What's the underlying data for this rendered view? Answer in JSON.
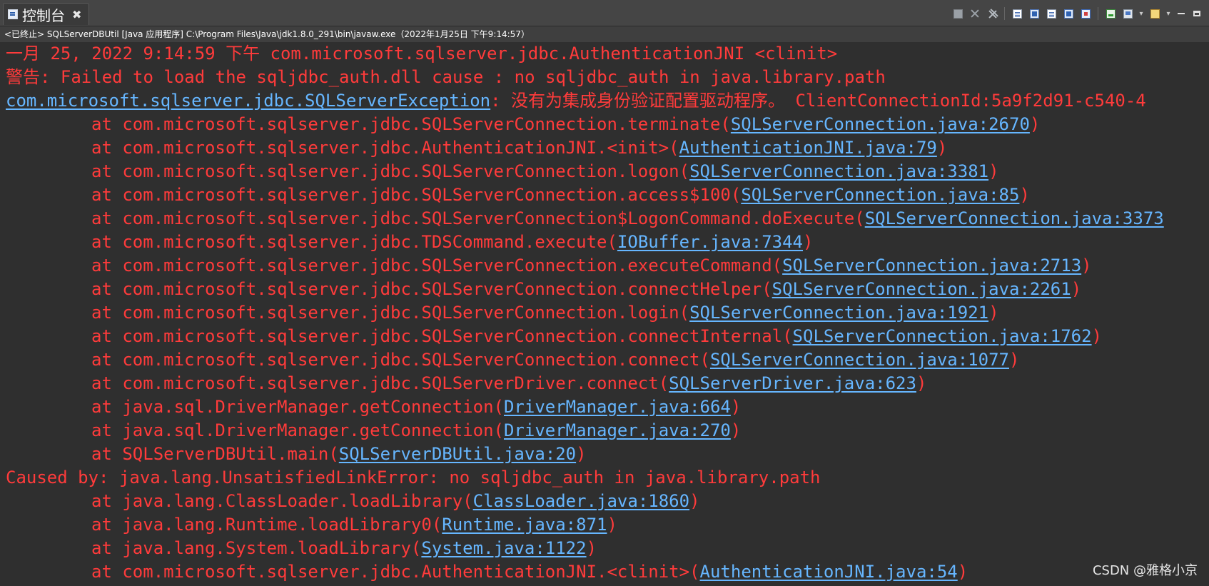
{
  "tab": {
    "title": "控制台",
    "close_label": "✖"
  },
  "status_line": "<已终止> SQLServerDBUtil [Java 应用程序] C:\\Program Files\\Java\\jdk1.8.0_291\\bin\\javaw.exe（2022年1月25日 下午9:14:57）",
  "toolbar": {
    "icons": [
      "terminate-icon",
      "remove-launch-icon",
      "remove-all-terminated-icon",
      "scroll-lock-icon",
      "word-wrap-icon",
      "show-console-on-stdout-icon",
      "show-console-on-stderr-icon",
      "pin-console-icon",
      "open-console-icon",
      "display-selected-console-icon",
      "new-console-icon",
      "minimize-icon",
      "maximize-icon"
    ],
    "dropdown_glyph": "▾"
  },
  "console": {
    "lines": [
      {
        "text": "一月 25, 2022 9:14:59 下午 com.microsoft.sqlserver.jdbc.AuthenticationJNI <clinit>"
      },
      {
        "text": "警告: Failed to load the sqljdbc_auth.dll cause : no sqljdbc_auth in java.library.path"
      },
      {
        "link": "com.microsoft.sqlserver.jdbc.SQLServerException",
        "text": ": 没有为集成身份验证配置驱动程序。 ClientConnectionId:5a9f2d91-c540-4"
      },
      {
        "prefix": "at com.microsoft.sqlserver.jdbc.SQLServerConnection.terminate(",
        "link": "SQLServerConnection.java:2670",
        "suffix": ")"
      },
      {
        "prefix": "at com.microsoft.sqlserver.jdbc.AuthenticationJNI.<init>(",
        "link": "AuthenticationJNI.java:79",
        "suffix": ")"
      },
      {
        "prefix": "at com.microsoft.sqlserver.jdbc.SQLServerConnection.logon(",
        "link": "SQLServerConnection.java:3381",
        "suffix": ")"
      },
      {
        "prefix": "at com.microsoft.sqlserver.jdbc.SQLServerConnection.access$100(",
        "link": "SQLServerConnection.java:85",
        "suffix": ")"
      },
      {
        "prefix": "at com.microsoft.sqlserver.jdbc.SQLServerConnection$LogonCommand.doExecute(",
        "link": "SQLServerConnection.java:3373",
        "suffix": ""
      },
      {
        "prefix": "at com.microsoft.sqlserver.jdbc.TDSCommand.execute(",
        "link": "IOBuffer.java:7344",
        "suffix": ")"
      },
      {
        "prefix": "at com.microsoft.sqlserver.jdbc.SQLServerConnection.executeCommand(",
        "link": "SQLServerConnection.java:2713",
        "suffix": ")"
      },
      {
        "prefix": "at com.microsoft.sqlserver.jdbc.SQLServerConnection.connectHelper(",
        "link": "SQLServerConnection.java:2261",
        "suffix": ")"
      },
      {
        "prefix": "at com.microsoft.sqlserver.jdbc.SQLServerConnection.login(",
        "link": "SQLServerConnection.java:1921",
        "suffix": ")"
      },
      {
        "prefix": "at com.microsoft.sqlserver.jdbc.SQLServerConnection.connectInternal(",
        "link": "SQLServerConnection.java:1762",
        "suffix": ")"
      },
      {
        "prefix": "at com.microsoft.sqlserver.jdbc.SQLServerConnection.connect(",
        "link": "SQLServerConnection.java:1077",
        "suffix": ")"
      },
      {
        "prefix": "at com.microsoft.sqlserver.jdbc.SQLServerDriver.connect(",
        "link": "SQLServerDriver.java:623",
        "suffix": ")"
      },
      {
        "prefix": "at java.sql.DriverManager.getConnection(",
        "link": "DriverManager.java:664",
        "suffix": ")"
      },
      {
        "prefix": "at java.sql.DriverManager.getConnection(",
        "link": "DriverManager.java:270",
        "suffix": ")"
      },
      {
        "prefix": "at SQLServerDBUtil.main(",
        "link": "SQLServerDBUtil.java:20",
        "suffix": ")"
      },
      {
        "text": "Caused by: java.lang.UnsatisfiedLinkError: no sqljdbc_auth in java.library.path"
      },
      {
        "prefix": "at java.lang.ClassLoader.loadLibrary(",
        "link": "ClassLoader.java:1860",
        "suffix": ")"
      },
      {
        "prefix": "at java.lang.Runtime.loadLibrary0(",
        "link": "Runtime.java:871",
        "suffix": ")"
      },
      {
        "prefix": "at java.lang.System.loadLibrary(",
        "link": "System.java:1122",
        "suffix": ")"
      },
      {
        "prefix": "at com.microsoft.sqlserver.jdbc.AuthenticationJNI.<clinit>(",
        "link": "AuthenticationJNI.java:54",
        "suffix": ")"
      }
    ]
  },
  "watermark": "CSDN @雅格小京",
  "colors": {
    "error_text": "#ff3b3b",
    "link_text": "#66b6ff",
    "background": "#2f2f2f",
    "titlebar": "#454545"
  }
}
